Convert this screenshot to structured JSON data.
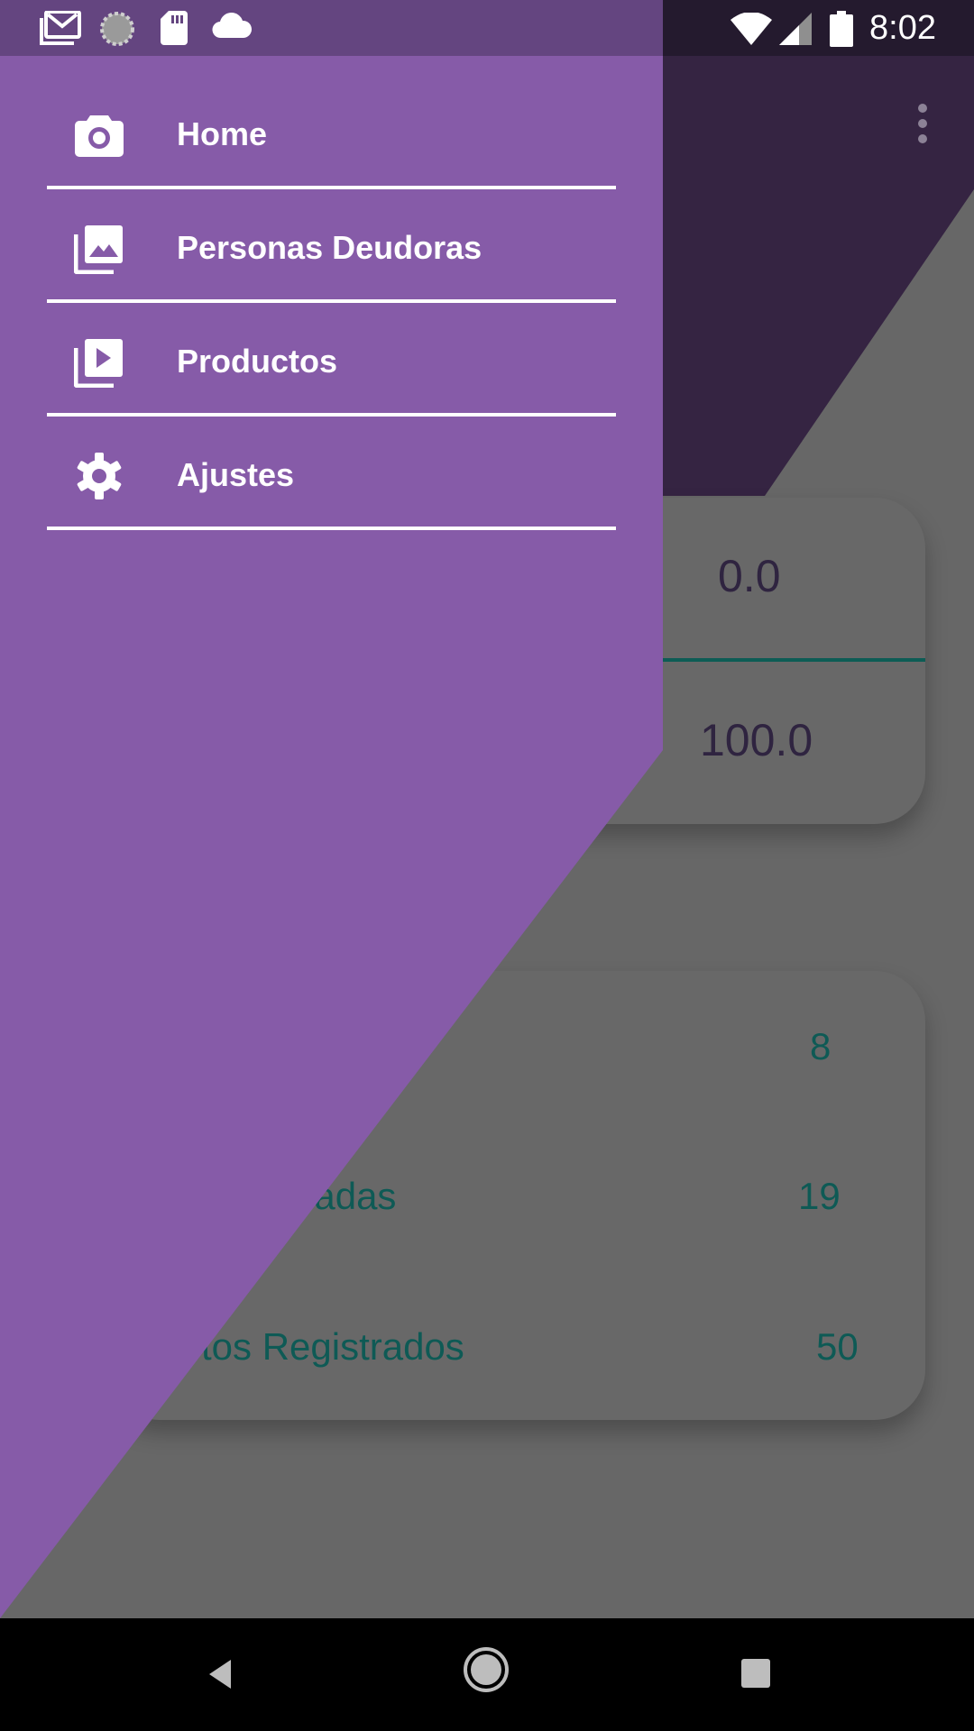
{
  "status_bar": {
    "time": "8:02",
    "left_icons": [
      "gmail-icon",
      "sync-icon",
      "sd-card-icon",
      "cloud-icon"
    ],
    "right_icons": [
      "wifi-icon",
      "signal-icon",
      "battery-icon"
    ]
  },
  "drawer": {
    "items": [
      {
        "label": "Home",
        "icon": "camera-icon"
      },
      {
        "label": "Personas Deudoras",
        "icon": "photo-library-icon"
      },
      {
        "label": "Productos",
        "icon": "video-library-icon"
      },
      {
        "label": "Ajustes",
        "icon": "gear-icon"
      }
    ]
  },
  "background": {
    "card1": {
      "value_top": "0.0",
      "value_bottom": "100.0"
    },
    "card2": {
      "rows": [
        {
          "label": "",
          "value": "8"
        },
        {
          "label": "dadas",
          "value": "19"
        },
        {
          "label": "ctos Registrados",
          "value": "50"
        }
      ]
    }
  },
  "colors": {
    "drawer": "#865ba8",
    "header": "#352442",
    "accent_teal": "#0e5a55"
  }
}
